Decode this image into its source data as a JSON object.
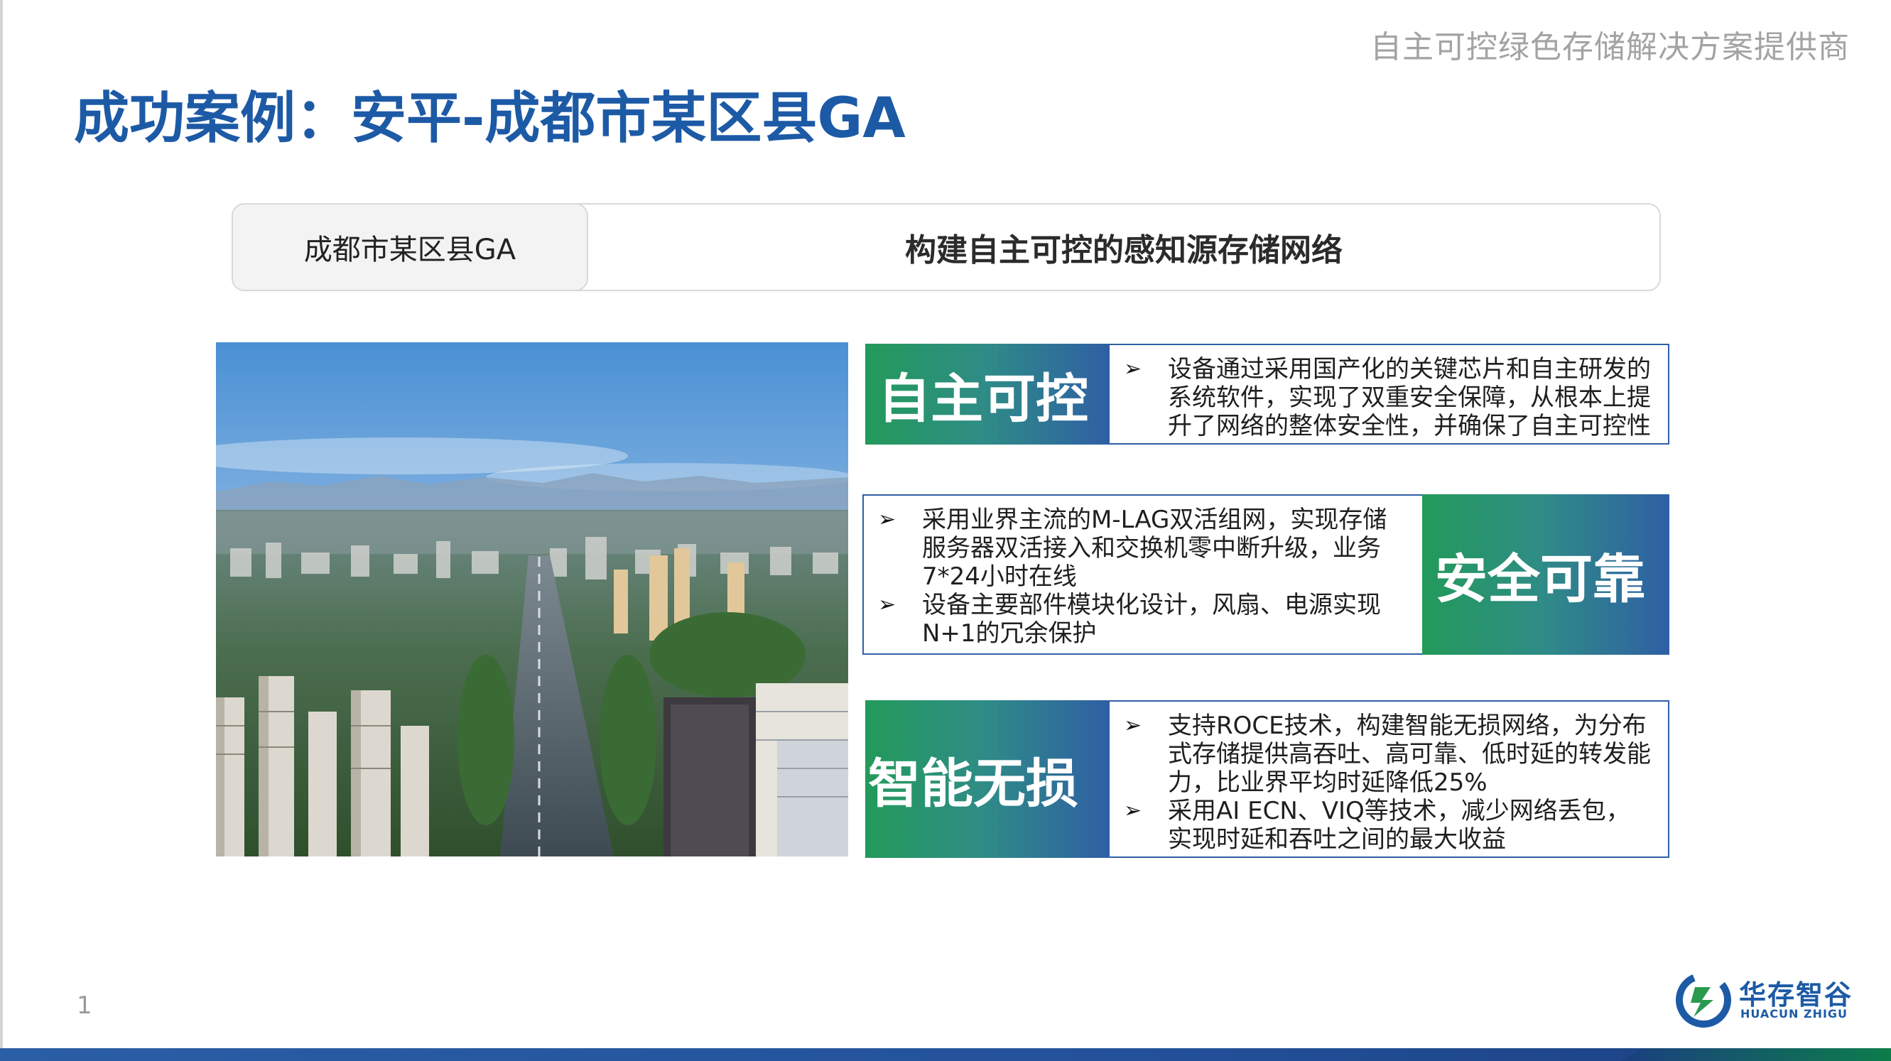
{
  "header": {
    "tagline": "自主可控绿色存储解决方案提供商",
    "title": "成功案例：安平-成都市某区县GA"
  },
  "case_bar": {
    "client": "成都市某区县GA",
    "heading": "构建自主可控的感知源存储网络"
  },
  "features": [
    {
      "label": "自主可控",
      "bullets": [
        "设备通过采用国产化的关键芯片和自主研发的系统软件，实现了双重安全保障，从根本上提升了网络的整体安全性，并确保了自主可控性"
      ]
    },
    {
      "label": "安全可靠",
      "bullets": [
        "采用业界主流的M-LAG双活组网，实现存储服务器双活接入和交换机零中断升级，业务7*24小时在线",
        "设备主要部件模块化设计，风扇、电源实现N+1的冗余保护"
      ]
    },
    {
      "label": "智能无损",
      "bullets": [
        "支持ROCE技术，构建智能无损网络，为分布式存储提供高吞吐、高可靠、低时延的转发能力，比业界平均时延降低25%",
        "采用AI ECN、VIQ等技术，减少网络丢包，实现时延和吞吐之间的最大收益"
      ]
    }
  ],
  "bullet_mark": "➢",
  "page_number": "1",
  "logo": {
    "name_cn": "华存智谷",
    "name_en": "HUACUN ZHIGU"
  },
  "colors": {
    "title_blue": "#1d5aa6",
    "gradient_green": "#239a5a",
    "gradient_blue": "#2f5fa5",
    "tagline_grey": "#a3a3a3"
  }
}
